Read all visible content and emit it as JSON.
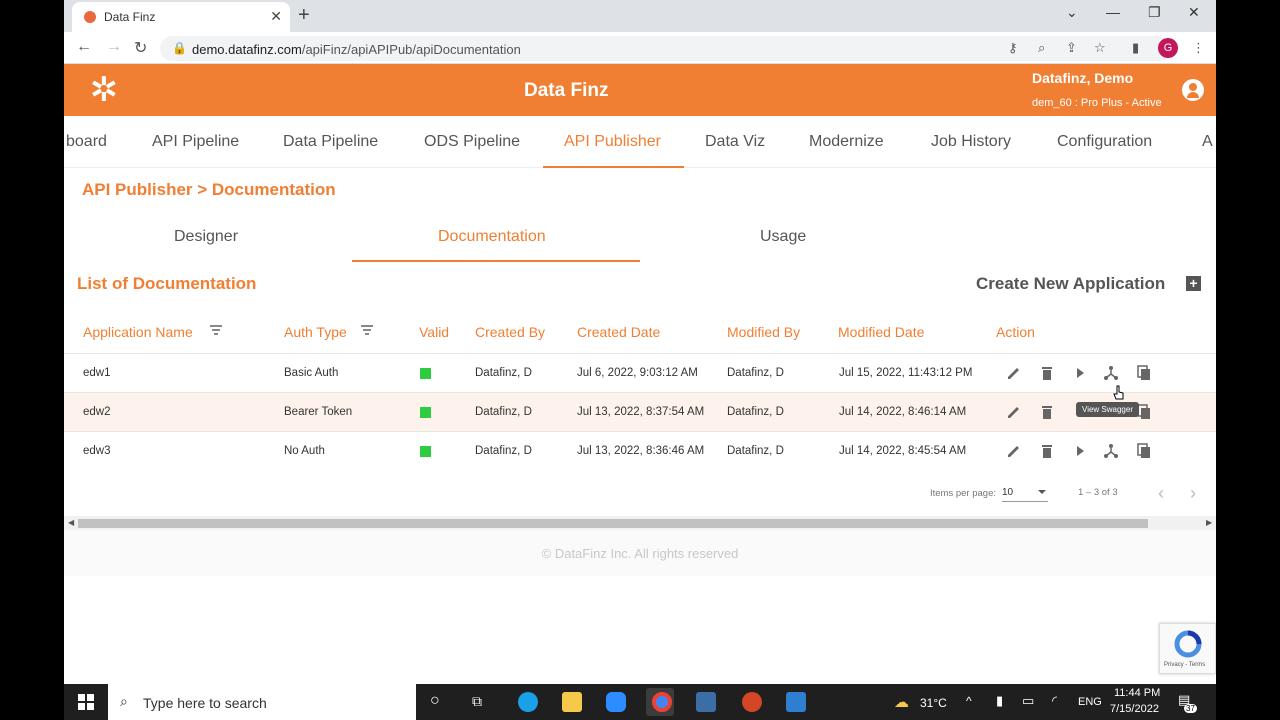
{
  "browser": {
    "tab_title": "Data Finz",
    "url_host": "demo.datafinz.com",
    "url_path": "/apiFinz/apiAPIPub/apiDocumentation",
    "profile_initial": "G"
  },
  "header": {
    "app_title": "Data Finz",
    "user_name": "Datafinz, Demo",
    "user_plan": "dem_60 : Pro Plus - Active",
    "accent_color": "#f07f33"
  },
  "nav": {
    "items": [
      "board",
      "API Pipeline",
      "Data Pipeline",
      "ODS Pipeline",
      "API Publisher",
      "Data Viz",
      "Modernize",
      "Job History",
      "Configuration",
      "A"
    ],
    "active": "API Publisher"
  },
  "breadcrumb": "API Publisher > Documentation",
  "subtabs": {
    "items": [
      "Designer",
      "Documentation",
      "Usage"
    ],
    "active": "Documentation"
  },
  "list": {
    "title": "List of Documentation",
    "create_label": "Create New Application"
  },
  "table": {
    "headers": [
      "Application Name",
      "Auth Type",
      "Valid",
      "Created By",
      "Created Date",
      "Modified By",
      "Modified Date",
      "Action"
    ],
    "rows": [
      {
        "name": "edw1",
        "auth": "Basic Auth",
        "created_by": "Datafinz, D",
        "created_date": "Jul 6, 2022, 9:03:12 AM",
        "modified_by": "Datafinz, D",
        "modified_date": "Jul 15, 2022, 11:43:12 PM"
      },
      {
        "name": "edw2",
        "auth": "Bearer Token",
        "created_by": "Datafinz, D",
        "created_date": "Jul 13, 2022, 8:37:54 AM",
        "modified_by": "Datafinz, D",
        "modified_date": "Jul 14, 2022, 8:46:14 AM"
      },
      {
        "name": "edw3",
        "auth": "No Auth",
        "created_by": "Datafinz, D",
        "created_date": "Jul 13, 2022, 8:36:46 AM",
        "modified_by": "Datafinz, D",
        "modified_date": "Jul 14, 2022, 8:45:54 AM"
      }
    ],
    "valid_color": "#2ecc40"
  },
  "tooltip": "View Swagger",
  "paginator": {
    "items_per_page_label": "Items per page:",
    "page_size": "10",
    "range": "1 – 3 of 3"
  },
  "footer": "© DataFinz Inc. All rights reserved",
  "taskbar": {
    "search_placeholder": "Type here to search",
    "temperature": "31°C",
    "language": "ENG",
    "time": "11:44 PM",
    "date": "7/15/2022",
    "notification_count": "37"
  }
}
